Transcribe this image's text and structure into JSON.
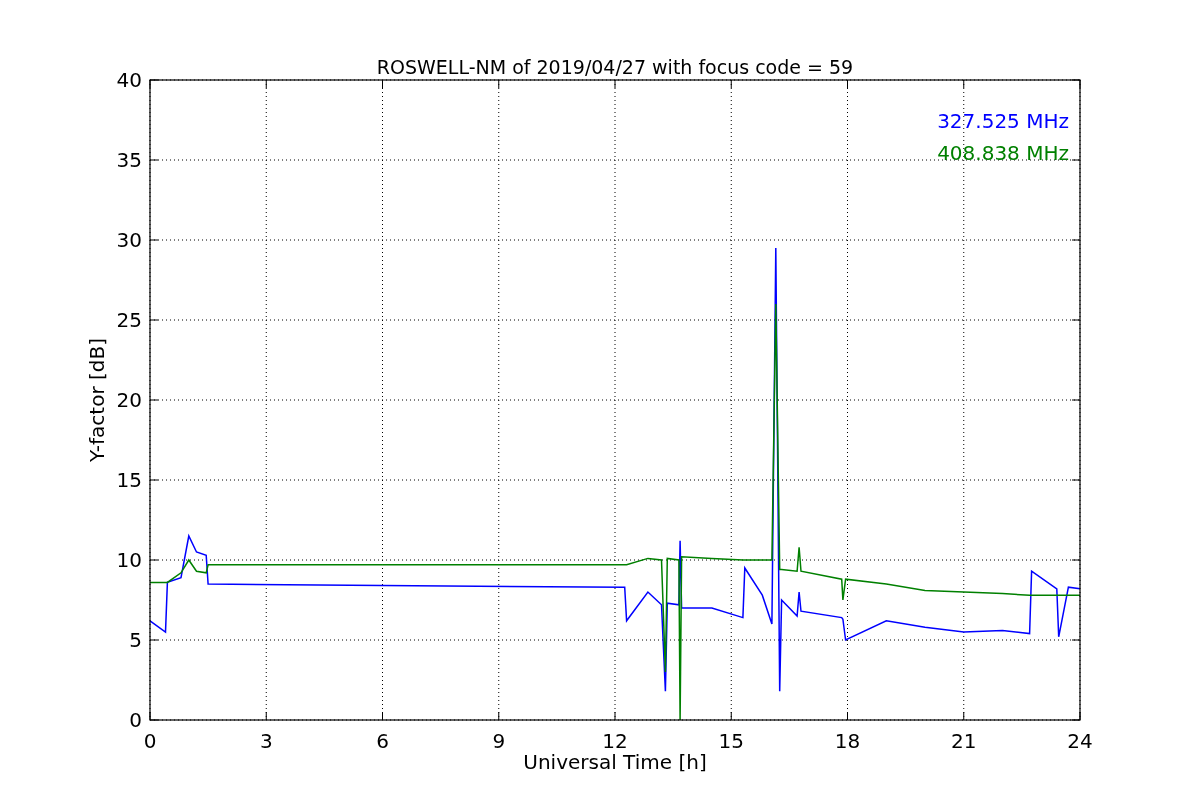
{
  "chart_data": {
    "type": "line",
    "title": "ROSWELL-NM of 2019/04/27 with focus code = 59",
    "xlabel": "Universal Time [h]",
    "ylabel": "Y-factor [dB]",
    "x": [
      0,
      0.4,
      0.45,
      0.8,
      1.0,
      1.2,
      1.45,
      1.5,
      6,
      12.25,
      12.3,
      12.85,
      13.2,
      13.3,
      13.35,
      13.65,
      13.68,
      13.72,
      14.5,
      15.3,
      15.35,
      15.8,
      16.05,
      16.15,
      16.25,
      16.3,
      16.7,
      16.75,
      16.8,
      17.85,
      17.88,
      17.95,
      19,
      20,
      21,
      22,
      22.7,
      22.75,
      23.4,
      23.45,
      23.7,
      24
    ],
    "series": [
      {
        "name": "327.525 MHz",
        "color": "#0000ff",
        "values": [
          6.2,
          5.5,
          8.6,
          8.9,
          11.5,
          10.5,
          10.3,
          8.5,
          8.4,
          8.3,
          6.2,
          8.0,
          7.2,
          1.8,
          7.3,
          7.2,
          11.2,
          7.0,
          7.0,
          6.4,
          9.5,
          7.8,
          6.0,
          29.5,
          1.8,
          7.5,
          6.5,
          8.0,
          6.8,
          6.4,
          6.3,
          5.0,
          6.2,
          5.8,
          5.5,
          5.6,
          5.4,
          9.3,
          8.2,
          5.2,
          8.3,
          8.2
        ]
      },
      {
        "name": "408.838 MHz",
        "color": "#008000",
        "values": [
          8.6,
          8.6,
          8.6,
          9.2,
          10.0,
          9.3,
          9.2,
          9.7,
          9.7,
          9.7,
          9.7,
          10.1,
          10.0,
          3.0,
          10.1,
          10.0,
          0,
          10.2,
          10.1,
          10.0,
          10.0,
          10.0,
          10.0,
          26,
          9.4,
          9.4,
          9.3,
          10.8,
          9.3,
          8.8,
          7.5,
          8.8,
          8.5,
          8.1,
          8.0,
          7.9,
          7.8,
          7.8,
          7.8,
          7.8,
          7.8,
          7.8
        ]
      }
    ],
    "xlim": [
      0,
      24
    ],
    "ylim": [
      0,
      40
    ],
    "xticks": [
      0,
      3,
      6,
      9,
      12,
      15,
      18,
      21,
      24
    ],
    "yticks": [
      0,
      5,
      10,
      15,
      20,
      25,
      30,
      35,
      40
    ],
    "grid": true
  }
}
